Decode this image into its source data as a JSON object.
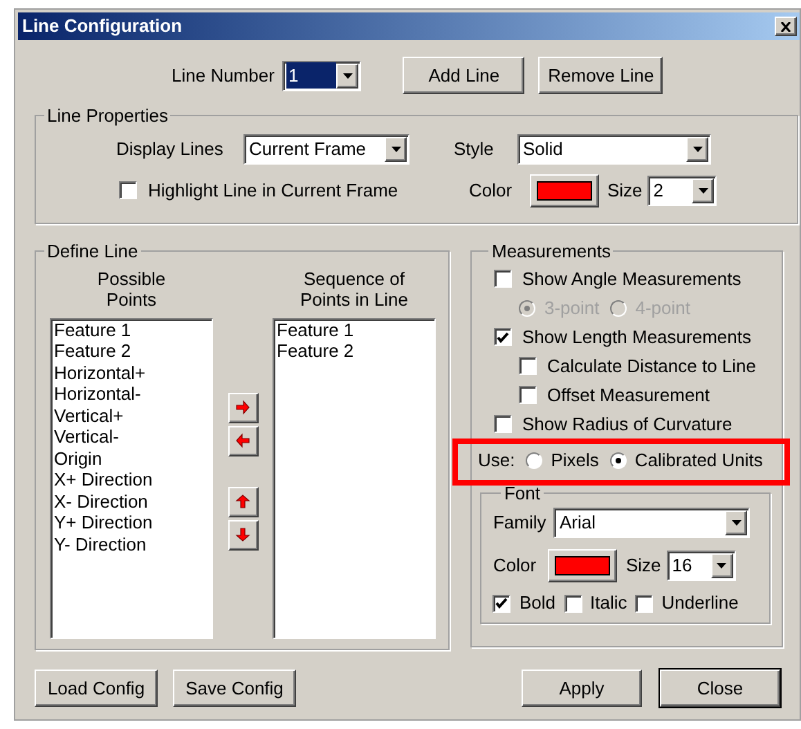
{
  "window": {
    "title": "Line Configuration"
  },
  "line_number": {
    "label": "Line Number",
    "value": "1"
  },
  "top_buttons": [
    "Add Line",
    "Remove Line"
  ],
  "line_properties": {
    "title": "Line Properties",
    "display_lines": {
      "label": "Display Lines",
      "value": "Current Frame"
    },
    "highlight": {
      "label": "Highlight Line in Current Frame",
      "checked": false
    },
    "style": {
      "label": "Style",
      "value": "Solid"
    },
    "color": {
      "label": "Color",
      "color": "#ff0000"
    },
    "size": {
      "label": "Size",
      "value": "2"
    }
  },
  "define_line": {
    "title": "Define Line",
    "possible": {
      "heading": "Possible Points",
      "items": [
        "Feature 1",
        "Feature 2",
        "Horizontal+",
        "Horizontal-",
        "Vertical+",
        "Vertical-",
        "Origin",
        "X+ Direction",
        "X- Direction",
        "Y+ Direction",
        "Y- Direction"
      ]
    },
    "sequence": {
      "heading": "Sequence of Points in Line",
      "items": [
        "Feature 1",
        "Feature 2"
      ]
    },
    "arrow_buttons": [
      {
        "kind": "right"
      },
      {
        "kind": "left"
      },
      {
        "kind": "up"
      },
      {
        "kind": "down"
      }
    ]
  },
  "measurements": {
    "title": "Measurements",
    "options": [
      {
        "kind": "checkbox",
        "label": "Show Angle Measurements",
        "checked": false,
        "indent": false
      },
      {
        "kind": "radios",
        "options": [
          {
            "label": "3-point",
            "selected": true,
            "disabled": true
          },
          {
            "label": "4-point",
            "selected": false,
            "disabled": true
          }
        ]
      },
      {
        "kind": "checkbox",
        "label": "Show Length Measurements",
        "checked": true,
        "indent": false
      },
      {
        "kind": "checkbox",
        "label": "Calculate Distance to Line",
        "checked": false,
        "indent": true
      },
      {
        "kind": "checkbox",
        "label": "Offset Measurement",
        "checked": false,
        "indent": true
      },
      {
        "kind": "checkbox",
        "label": "Show Radius of Curvature",
        "checked": false,
        "indent": false
      }
    ],
    "units": {
      "label": "Use:",
      "options": [
        {
          "label": "Pixels",
          "selected": false
        },
        {
          "label": "Calibrated Units",
          "selected": true
        }
      ]
    },
    "font": {
      "title": "Font",
      "family": {
        "label": "Family",
        "value": "Arial"
      },
      "color": {
        "label": "Color",
        "color": "#ff0000"
      },
      "size": {
        "label": "Size",
        "value": "16"
      },
      "styles": [
        {
          "label": "Bold",
          "checked": true
        },
        {
          "label": "Italic",
          "checked": false
        },
        {
          "label": "Underline",
          "checked": false
        }
      ]
    }
  },
  "bottom_left_buttons": [
    "Load Config",
    "Save Config"
  ],
  "bottom_right_buttons": [
    {
      "label": "Apply",
      "default": false
    },
    {
      "label": "Close",
      "default": true
    }
  ]
}
